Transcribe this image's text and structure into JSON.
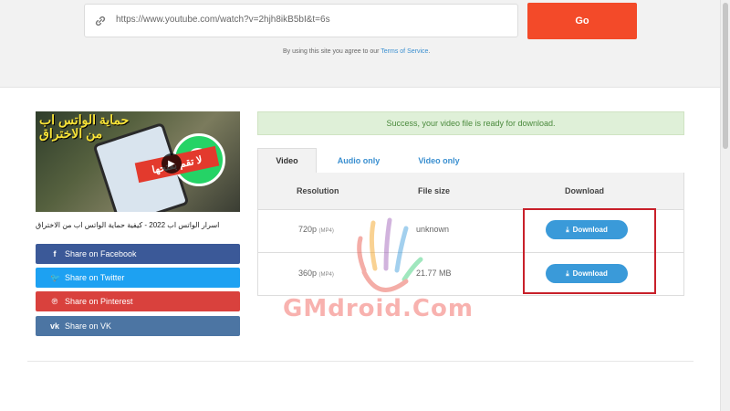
{
  "search": {
    "url_value": "https://www.youtube.com/watch?v=2hjh8ikB5bI&t=6s",
    "go_label": "Go",
    "terms_prefix": "By using this site you agree to our",
    "terms_link": "Terms of Service",
    "terms_suffix": "."
  },
  "video": {
    "thumbnail_text_title": "حماية الواتس اب من الاختراق",
    "thumbnail_text_band": "لا تقم بفتحها",
    "title": "اسرار الواتس اب 2022 - كيفية حماية الواتس اب من الاختراق"
  },
  "share": [
    {
      "icon": "f",
      "label": "Share on Facebook"
    },
    {
      "icon": "🐦",
      "label": "Share on Twitter"
    },
    {
      "icon": "℗",
      "label": "Share on Pinterest"
    },
    {
      "icon": "vk",
      "label": "Share on VK"
    }
  ],
  "status": {
    "success_message": "Success, your video file is ready for download."
  },
  "tabs": [
    {
      "label": "Video",
      "active": true
    },
    {
      "label": "Audio only",
      "active": false
    },
    {
      "label": "Video only",
      "active": false
    }
  ],
  "table": {
    "headers": [
      "Resolution",
      "File size",
      "Download"
    ],
    "rows": [
      {
        "resolution": "720p",
        "format": "(MP4)",
        "size": "unknown",
        "button": "Download"
      },
      {
        "resolution": "360p",
        "format": "(MP4)",
        "size": "21.77 MB",
        "button": "Download"
      }
    ]
  },
  "watermark": "GMdroid.Com",
  "colors": {
    "go_button": "#f34a29",
    "download_button": "#3a9ad9",
    "success_bg": "#dff0d8",
    "highlight_box": "#c8202a"
  }
}
